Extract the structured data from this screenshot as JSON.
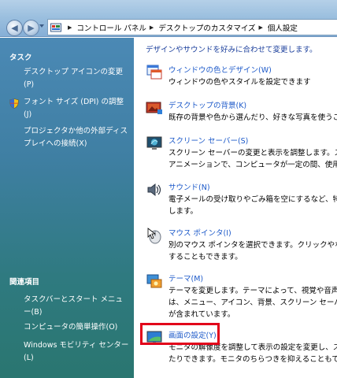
{
  "address": {
    "crumbs": [
      "コントロール パネル",
      "デスクトップのカスタマイズ",
      "個人設定"
    ]
  },
  "sidebar": {
    "tasks_header": "タスク",
    "tasks": [
      "デスクトップ アイコンの変更(P)",
      "フォント サイズ (DPI) の調整(J)",
      "プロジェクタか他の外部ディスプレイへの接続(X)"
    ],
    "related_header": "関連項目",
    "related": [
      "タスクバーとスタート メニュー(B)",
      "コンピュータの簡単操作(O)",
      "Windows モビリティ センター(L)"
    ]
  },
  "main": {
    "intro": "デザインやサウンドを好みに合わせて変更します。",
    "items": [
      {
        "title": "ウィンドウの色とデザイン(W)",
        "desc": "ウィンドウの色やスタイルを設定できます"
      },
      {
        "title": "デスクトップの背景(K)",
        "desc": "既存の背景や色から選んだり、好きな写真を使うこ"
      },
      {
        "title": "スクリーン セーバー(S)",
        "desc": "スクリーン セーバーの変更と表示を調整します。ス\nアニメーションで、コンピュータが一定の間、使用"
      },
      {
        "title": "サウンド(N)",
        "desc": "電子メールの受け取りやごみ箱を空にするなど、特定\nします。"
      },
      {
        "title": "マウス ポインタ(I)",
        "desc": "別のマウス ポインタを選択できます。クリックやな\nすることもできます。"
      },
      {
        "title": "テーマ(M)",
        "desc": "テーマを変更します。テーマによって、視覚や音声\nは、メニュー、アイコン、背景、スクリーン セーバ\nが含まれています。"
      },
      {
        "title": "画面の設定(Y)",
        "desc": "モニタの解像度を調整して表示の設定を変更し、ス\nたりできます。モニタのちらつきを抑えることもでき"
      }
    ]
  },
  "colors": {
    "link": "#1c59c9",
    "intro": "#1b3f9c",
    "highlight": "#e2001a",
    "sidebar_top": "#4b89b5",
    "sidebar_bottom": "#2a7670"
  }
}
